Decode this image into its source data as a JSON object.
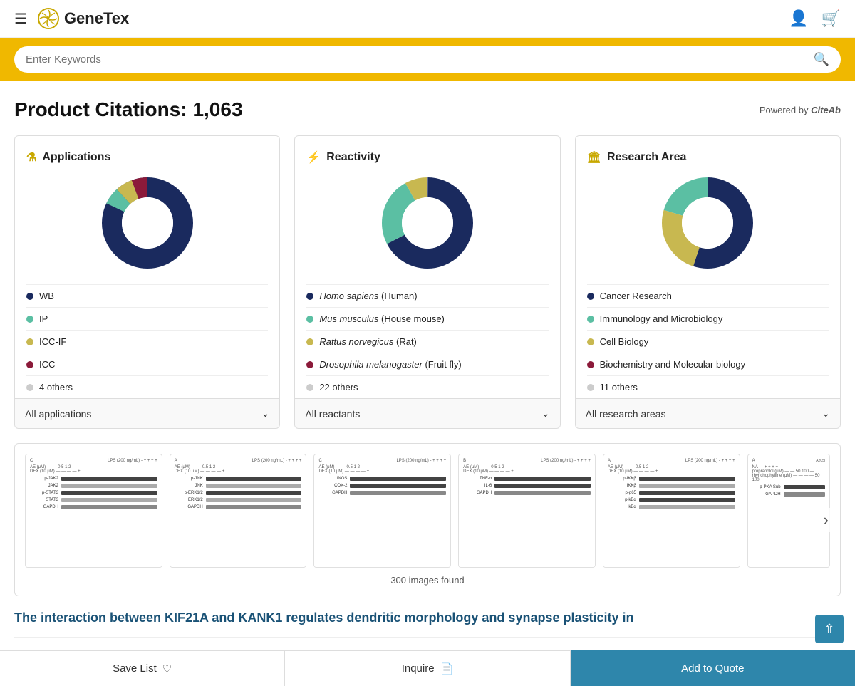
{
  "header": {
    "logo_text": "GeneTex",
    "search_placeholder": "Enter Keywords"
  },
  "citations": {
    "title": "Product Citations: 1,063",
    "powered_by_label": "Powered by",
    "powered_by_brand": "CiteAb"
  },
  "applications_card": {
    "icon": "🔬",
    "title": "Applications",
    "dropdown_label": "All applications",
    "legend": [
      {
        "label": "WB",
        "color": "#1a2a5e"
      },
      {
        "label": "IP",
        "color": "#5bbfa3"
      },
      {
        "label": "ICC-IF",
        "color": "#c8b850"
      },
      {
        "label": "ICC",
        "color": "#8b1a3a"
      },
      {
        "label": "4 others",
        "color": "#cccccc"
      }
    ],
    "chart": {
      "segments": [
        {
          "color": "#1a2a5e",
          "pct": 82
        },
        {
          "color": "#5bbfa3",
          "pct": 5
        },
        {
          "color": "#c8b850",
          "pct": 5
        },
        {
          "color": "#8b1a3a",
          "pct": 5
        },
        {
          "color": "#cccccc",
          "pct": 3
        }
      ]
    }
  },
  "reactivity_card": {
    "icon": "⚡",
    "title": "Reactivity",
    "dropdown_label": "All reactants",
    "legend": [
      {
        "label": "Homo sapiens (Human)",
        "color": "#1a2a5e",
        "italic_prefix": "Homo sapiens",
        "normal_suffix": " (Human)"
      },
      {
        "label": "Mus musculus (House mouse)",
        "color": "#5bbfa3",
        "italic_prefix": "Mus musculus",
        "normal_suffix": " (House mouse)"
      },
      {
        "label": "Rattus norvegicus (Rat)",
        "color": "#c8b850",
        "italic_prefix": "Rattus norvegicus",
        "normal_suffix": " (Rat)"
      },
      {
        "label": "Drosophila melanogaster (Fruit fly)",
        "color": "#8b1a3a",
        "italic_prefix": "Drosophila melanogaster",
        "normal_suffix": " (Fruit fly)"
      },
      {
        "label": "22 others",
        "color": "#cccccc"
      }
    ],
    "chart": {
      "segments": [
        {
          "color": "#1a2a5e",
          "pct": 55
        },
        {
          "color": "#5bbfa3",
          "pct": 20
        },
        {
          "color": "#c8b850",
          "pct": 12
        },
        {
          "color": "#8b1a3a",
          "pct": 8
        },
        {
          "color": "#cccccc",
          "pct": 5
        }
      ]
    }
  },
  "research_area_card": {
    "icon": "🏛",
    "title": "Research Area",
    "dropdown_label": "All research areas",
    "legend": [
      {
        "label": "Cancer Research",
        "color": "#1a2a5e"
      },
      {
        "label": "Immunology and Microbiology",
        "color": "#5bbfa3"
      },
      {
        "label": "Cell Biology",
        "color": "#c8b850"
      },
      {
        "label": "Biochemistry and Molecular biology",
        "color": "#8b1a3a"
      },
      {
        "label": "11 others",
        "color": "#cccccc"
      }
    ],
    "chart": {
      "segments": [
        {
          "color": "#1a2a5e",
          "pct": 45
        },
        {
          "color": "#c8b850",
          "pct": 20
        },
        {
          "color": "#5bbfa3",
          "pct": 20
        },
        {
          "color": "#8b1a3a",
          "pct": 10
        },
        {
          "color": "#cccccc",
          "pct": 5
        }
      ]
    }
  },
  "images_section": {
    "count_label": "300 images found"
  },
  "article": {
    "title": "The interaction between KIF21A and KANK1 regulates dendritic morphology and synapse plasticity in"
  },
  "bottom_bar": {
    "save_label": "Save List",
    "inquire_label": "Inquire",
    "quote_label": "Add to Quote"
  }
}
